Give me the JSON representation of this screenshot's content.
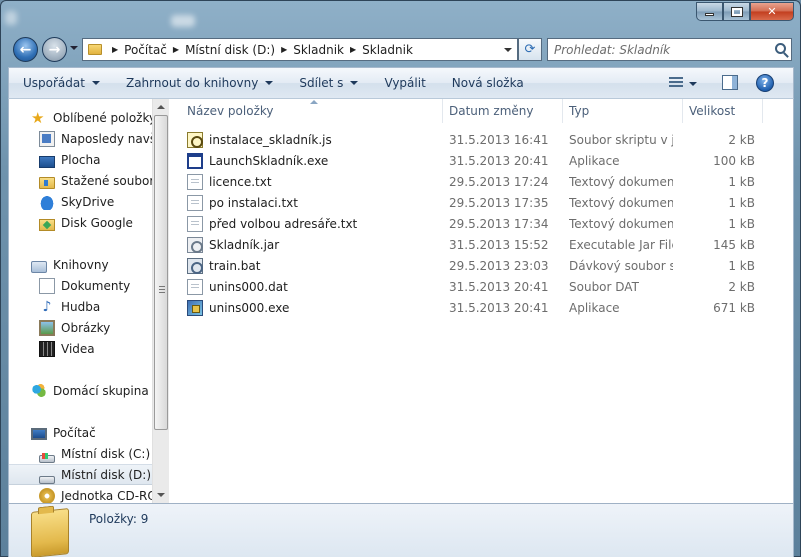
{
  "navigation": {
    "breadcrumbs": [
      "Počítač",
      "Místní disk (D:)",
      "Skladnik",
      "Skladnik"
    ],
    "search_placeholder": "Prohledat: Skladník"
  },
  "toolbar": {
    "organize": "Uspořádat",
    "include_library": "Zahrnout do knihovny",
    "share": "Sdílet s",
    "burn": "Vypálit",
    "new_folder": "Nová složka"
  },
  "sidebar": {
    "favorites": "Oblíbené položky",
    "favorites_items": [
      {
        "label": "Naposledy navští",
        "icon": "recent-places-icon"
      },
      {
        "label": "Plocha",
        "icon": "desktop-icon"
      },
      {
        "label": "Stažené soubory",
        "icon": "downloads-folder-icon"
      },
      {
        "label": "SkyDrive",
        "icon": "skydrive-cloud-icon"
      },
      {
        "label": "Disk Google",
        "icon": "google-drive-folder-icon"
      }
    ],
    "libraries": "Knihovny",
    "library_items": [
      {
        "label": "Dokumenty",
        "icon": "documents-icon"
      },
      {
        "label": "Hudba",
        "icon": "music-icon"
      },
      {
        "label": "Obrázky",
        "icon": "pictures-icon"
      },
      {
        "label": "Videa",
        "icon": "videos-icon"
      }
    ],
    "homegroup": "Domácí skupina",
    "computer": "Počítač",
    "computer_items": [
      {
        "label": "Místní disk (C:)",
        "icon": "system-drive-icon"
      },
      {
        "label": "Místní disk (D:)",
        "icon": "drive-icon",
        "selected": true
      },
      {
        "label": "Jednotka CD-ROM",
        "icon": "cdrom-icon"
      }
    ]
  },
  "columns": {
    "name": "Název položky",
    "date": "Datum změny",
    "type": "Typ",
    "size": "Velikost"
  },
  "files": [
    {
      "name": "instalace_skladník.js",
      "date": "31.5.2013 16:41",
      "type": "Soubor skriptu v j...",
      "size": "2 kB",
      "icon": "script-file-icon"
    },
    {
      "name": "LaunchSkladník.exe",
      "date": "31.5.2013 20:41",
      "type": "Aplikace",
      "size": "100 kB",
      "icon": "application-icon"
    },
    {
      "name": "licence.txt",
      "date": "29.5.2013 17:24",
      "type": "Textový dokument",
      "size": "1 kB",
      "icon": "text-file-icon"
    },
    {
      "name": "po instalaci.txt",
      "date": "29.5.2013 17:35",
      "type": "Textový dokument",
      "size": "1 kB",
      "icon": "text-file-icon"
    },
    {
      "name": "před volbou adresáře.txt",
      "date": "29.5.2013 17:34",
      "type": "Textový dokument",
      "size": "1 kB",
      "icon": "text-file-icon"
    },
    {
      "name": "Skladník.jar",
      "date": "31.5.2013 15:52",
      "type": "Executable Jar File",
      "size": "145 kB",
      "icon": "jar-file-icon"
    },
    {
      "name": "train.bat",
      "date": "29.5.2013 23:03",
      "type": "Dávkový soubor s...",
      "size": "1 kB",
      "icon": "batch-file-icon"
    },
    {
      "name": "unins000.dat",
      "date": "31.5.2013 20:41",
      "type": "Soubor DAT",
      "size": "2 kB",
      "icon": "data-file-icon"
    },
    {
      "name": "unins000.exe",
      "date": "31.5.2013 20:41",
      "type": "Aplikace",
      "size": "671 kB",
      "icon": "setup-exe-icon"
    }
  ],
  "details": {
    "item_count": "Položky: 9"
  }
}
